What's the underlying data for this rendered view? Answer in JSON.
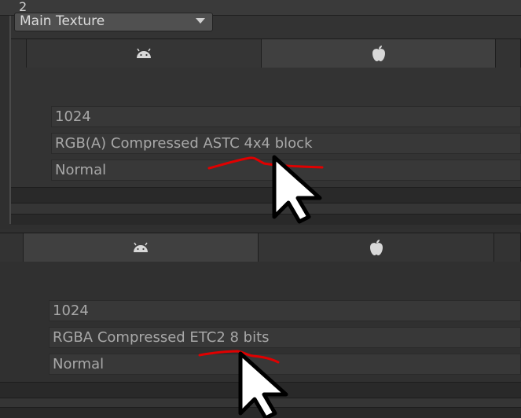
{
  "top_value": "2",
  "dropdown": {
    "selected": "Main Texture"
  },
  "platform_icons": [
    "android-icon",
    "apple-icon"
  ],
  "panels": [
    {
      "max_size": "1024",
      "format": "RGB(A) Compressed ASTC 4x4 block",
      "compression": "Normal",
      "active_tab": "apple"
    },
    {
      "max_size": "1024",
      "format": "RGBA Compressed ETC2 8 bits",
      "compression": "Normal",
      "active_tab": "android"
    }
  ],
  "colors": {
    "background": "#2f2f2f",
    "field": "#383838",
    "text": "#a8a8a8",
    "annotation": "#e00000"
  }
}
